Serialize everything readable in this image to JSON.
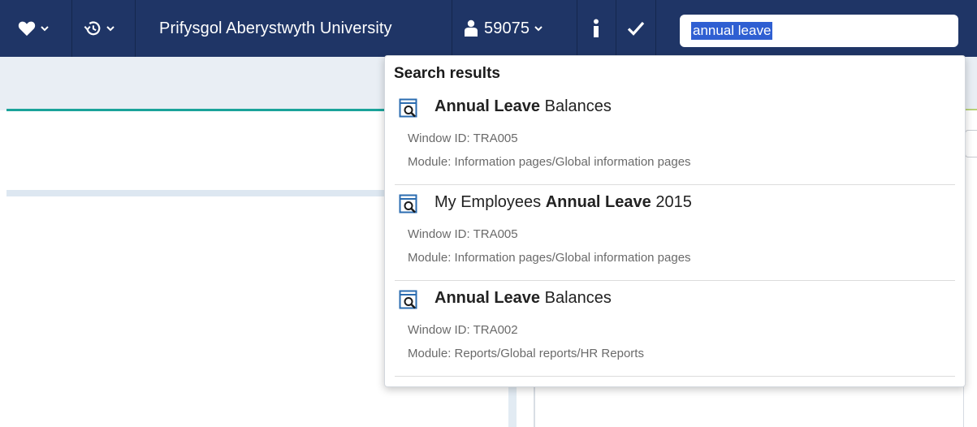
{
  "nav": {
    "org_name": "Prifysgol Aberystwyth University",
    "user_id": "59075",
    "icons": {
      "favourites": "heart-icon",
      "history": "history-icon",
      "user": "person-icon",
      "info": "info-icon",
      "tasks": "checkmark-icon",
      "dropdown": "chevron-down-icon"
    }
  },
  "search": {
    "value": "annual leave"
  },
  "results_panel": {
    "title": "Search results",
    "items": [
      {
        "title_bold": "Annual Leave",
        "title_pre": "",
        "title_post": " Balances",
        "window_id": "Window ID: TRA005",
        "module": "Module: Information pages/Global information pages"
      },
      {
        "title_pre": "My Employees ",
        "title_bold": "Annual Leave",
        "title_post": " 2015",
        "window_id": "Window ID: TRA005",
        "module": "Module: Information pages/Global information pages"
      },
      {
        "title_bold": "Annual Leave",
        "title_pre": "",
        "title_post": " Balances",
        "window_id": "Window ID: TRA002",
        "module": "Module: Reports/Global reports/HR Reports"
      }
    ]
  },
  "colors": {
    "topbar": "#1f3566",
    "subbar": "#e9eef4",
    "accent_teal": "#1aa39a",
    "search_highlight": "#2f5fd2",
    "result_icon": "#2b6cb0"
  }
}
